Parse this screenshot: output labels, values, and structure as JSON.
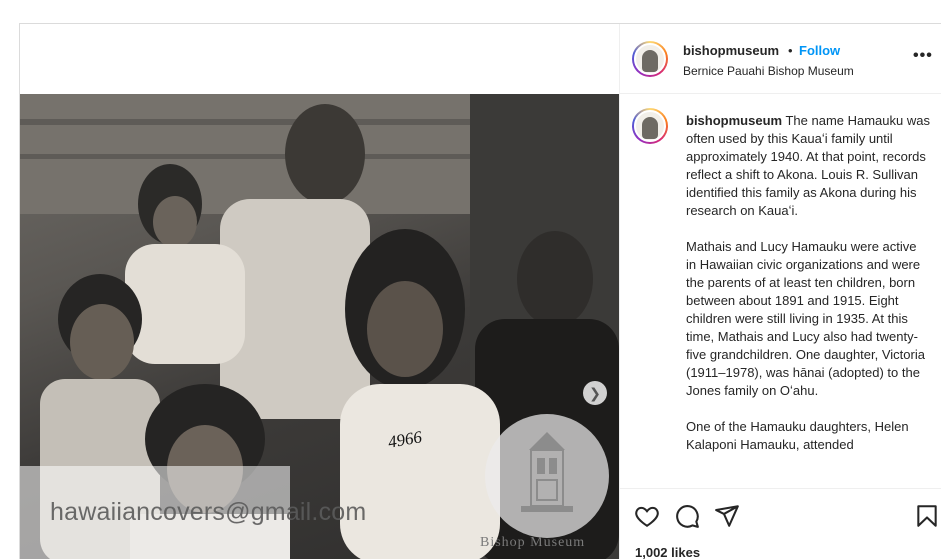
{
  "post": {
    "watermark_email": "hawaiiancovers@gmail.com",
    "museum_watermark": "Bishop Museum",
    "photo_number": "4966"
  },
  "header": {
    "username": "bishopmuseum",
    "separator": "•",
    "follow_label": "Follow",
    "subtitle": "Bernice Pauahi Bishop Museum",
    "more_label": "•••"
  },
  "caption": {
    "username": "bishopmuseum",
    "p1": "The name Hamauku was often used by this Kauaʻi family until approximately 1940. At that point, records reflect a shift to Akona. Louis R. Sullivan identified this family as Akona during his research on Kauaʻi.",
    "p2": "Mathais and Lucy Hamauku were active in Hawaiian civic organizations and were the parents of at least ten children, born between about 1891 and 1915. Eight children were still living in 1935. At this time, Mathais and Lucy also had twenty-five grandchildren. One daughter, Victoria (1911–1978), was hānai (adopted) to the Jones family on Oʻahu.",
    "p3": "One of the Hamauku daughters, Helen Kalaponi Hamauku, attended"
  },
  "footer": {
    "likes": "1,002 likes"
  },
  "icons": {
    "like": "heart-icon",
    "comment": "comment-icon",
    "share": "paper-plane-icon",
    "save": "bookmark-icon",
    "next": "chevron-right-icon"
  },
  "colors": {
    "follow": "#0095f6",
    "text": "#262626",
    "border": "#dbdbdb"
  }
}
